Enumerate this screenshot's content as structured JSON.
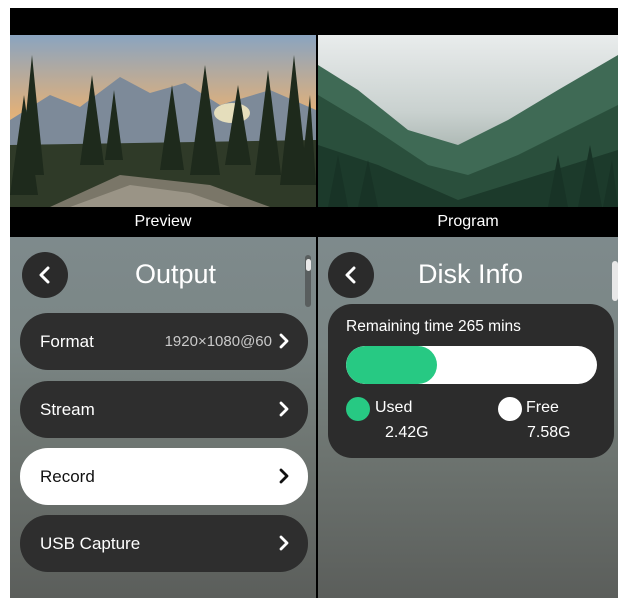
{
  "preview": {
    "caption": "Preview"
  },
  "program": {
    "caption": "Program"
  },
  "output": {
    "title": "Output",
    "items": [
      {
        "label": "Format",
        "value": "1920×1080@60",
        "active": false
      },
      {
        "label": "Stream",
        "value": "",
        "active": false
      },
      {
        "label": "Record",
        "value": "",
        "active": true
      },
      {
        "label": "USB Capture",
        "value": "",
        "active": false
      }
    ]
  },
  "disk": {
    "title": "Disk Info",
    "remaining_label": "Remaining time 265 mins",
    "used_fraction": 0.242,
    "used_label": "Used",
    "used_value": "2.42G",
    "free_label": "Free",
    "free_value": "7.58G"
  },
  "colors": {
    "accent": "#27c983",
    "dark_row": "#2e2e2e",
    "active_row": "#ffffff"
  },
  "icons": {
    "back": "chevron-left-icon",
    "row_chevron": "chevron-right-icon"
  }
}
